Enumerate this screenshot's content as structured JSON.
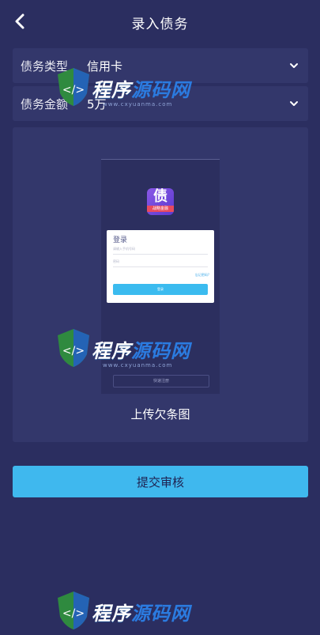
{
  "header": {
    "title": "录入债务"
  },
  "form": {
    "debt_type": {
      "label": "债务类型",
      "value": "信用卡"
    },
    "debt_amount": {
      "label": "债务金额",
      "value": "5万"
    }
  },
  "upload": {
    "caption": "上传欠条图",
    "preview": {
      "app_icon_glyph": "债",
      "app_icon_tag": "战略金融",
      "login_title": "登录",
      "phone_placeholder": "请输入手机号码",
      "password_placeholder": "密码",
      "forgot_label": "忘记密码?",
      "login_button": "登录",
      "register_button": "快速注册"
    }
  },
  "submit": {
    "label": "提交审核"
  },
  "watermark": {
    "brand_a": "程序",
    "brand_b": "源码网",
    "url": "www.cxyuanma.com"
  },
  "colors": {
    "background": "#2b2e60",
    "card": "#33376b",
    "accent": "#3fb8ee"
  }
}
